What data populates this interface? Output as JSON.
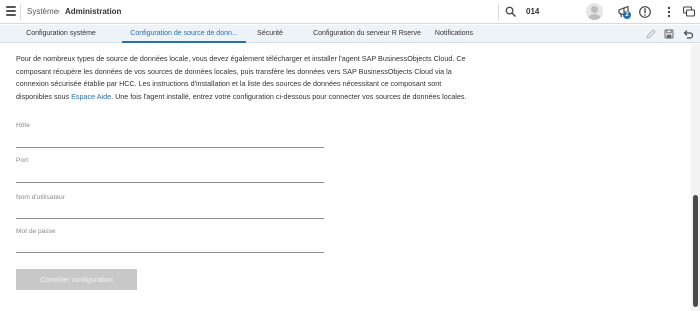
{
  "shell": {
    "breadcrumb": [
      "Système",
      "Administration"
    ],
    "breadcrumb_separator": "›",
    "tenant_id": "014",
    "notification_count": "2",
    "icons": [
      "menu-icon",
      "search-icon",
      "user-avatar",
      "notifications-icon",
      "help-icon",
      "more-vertical-icon",
      "feedback-icon"
    ]
  },
  "tabs": [
    {
      "label": "Configuration système",
      "active": false
    },
    {
      "label": "Configuration de source de donn...",
      "active": true
    },
    {
      "label": "Sécurité",
      "active": false
    },
    {
      "label": "Configuration du serveur R Rserve",
      "active": false
    },
    {
      "label": "Notifications",
      "active": false
    }
  ],
  "toolbar_icons": [
    "edit-icon",
    "save-icon",
    "undo-icon"
  ],
  "intro": {
    "text_before_link": "Pour de nombreux types de source de données locale, vous devez également télécharger et installer l'agent SAP BusinessObjects Cloud. Ce composant récupère les données de vos sources de données locales, puis transfère les données vers SAP BusinessObjects Cloud via la connexion sécurisée établie par HCC. Les instructions d'installation et la liste des sources de données nécessitant ce composant sont disponibles sous ",
    "link_text": "Espace Aide",
    "text_after_link": ". Une fois l'agent installé, entrez votre configuration ci-dessous pour connecter vos sources de données locales."
  },
  "form": {
    "fields": [
      {
        "label": "Hôte",
        "value": ""
      },
      {
        "label": "Port",
        "value": ""
      },
      {
        "label": "Nom d'utilisateur",
        "value": ""
      },
      {
        "label": "Mot de passe",
        "value": ""
      }
    ],
    "check_button": "Contrôler configuration"
  },
  "colors": {
    "accent": "#2a6fb0",
    "tabbar_bg": "#eef3f8",
    "button_disabled_bg": "#c8c8c8",
    "badge": "#1f6fb2"
  }
}
